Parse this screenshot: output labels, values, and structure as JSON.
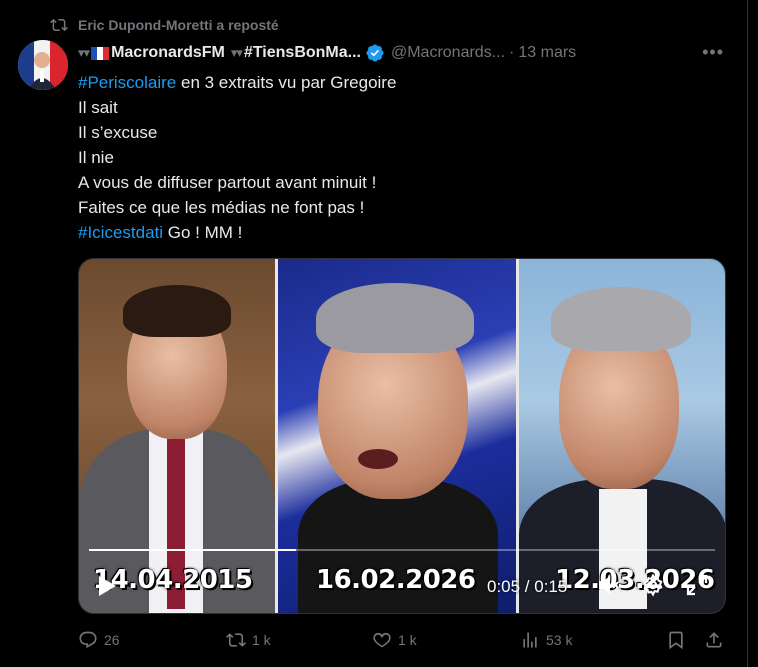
{
  "repost": {
    "label": "Eric Dupond-Moretti a reposté"
  },
  "author": {
    "name": "MacronardsFM",
    "name2": "#TiensBonMa...",
    "handle": "@Macronards...",
    "separator": "·",
    "date": "13 mars"
  },
  "tweet": {
    "line1_hashtag": "#Periscolaire",
    "line1_rest": " en 3 extraits vu par Gregoire",
    "line2": "Il sait",
    "line3": "Il s’excuse",
    "line4": "Il nie",
    "line5": "A vous de diffuser partout avant minuit !",
    "line6": "Faites ce que les médias ne font pas !",
    "line7_hashtag": "#Icicestdati",
    "line7_rest": " Go ! MM !"
  },
  "video": {
    "dates": [
      "14.04.2015",
      "16.02.2026",
      "12.03.2026"
    ],
    "time": "0:05 / 0:15",
    "progress": 0.33
  },
  "actions": {
    "replies": "26",
    "reposts": "1 k",
    "likes": "1 k",
    "views": "53 k"
  },
  "colors": {
    "accent": "#1d9bf0",
    "muted": "#71767b",
    "text": "#e7e9ea",
    "background": "#000000"
  },
  "icons": [
    "repost-icon",
    "verified-icon",
    "more-icon",
    "play-icon",
    "mute-icon",
    "settings-icon",
    "fullscreen-icon",
    "reply-icon",
    "like-icon",
    "views-icon",
    "bookmark-icon",
    "share-icon"
  ]
}
